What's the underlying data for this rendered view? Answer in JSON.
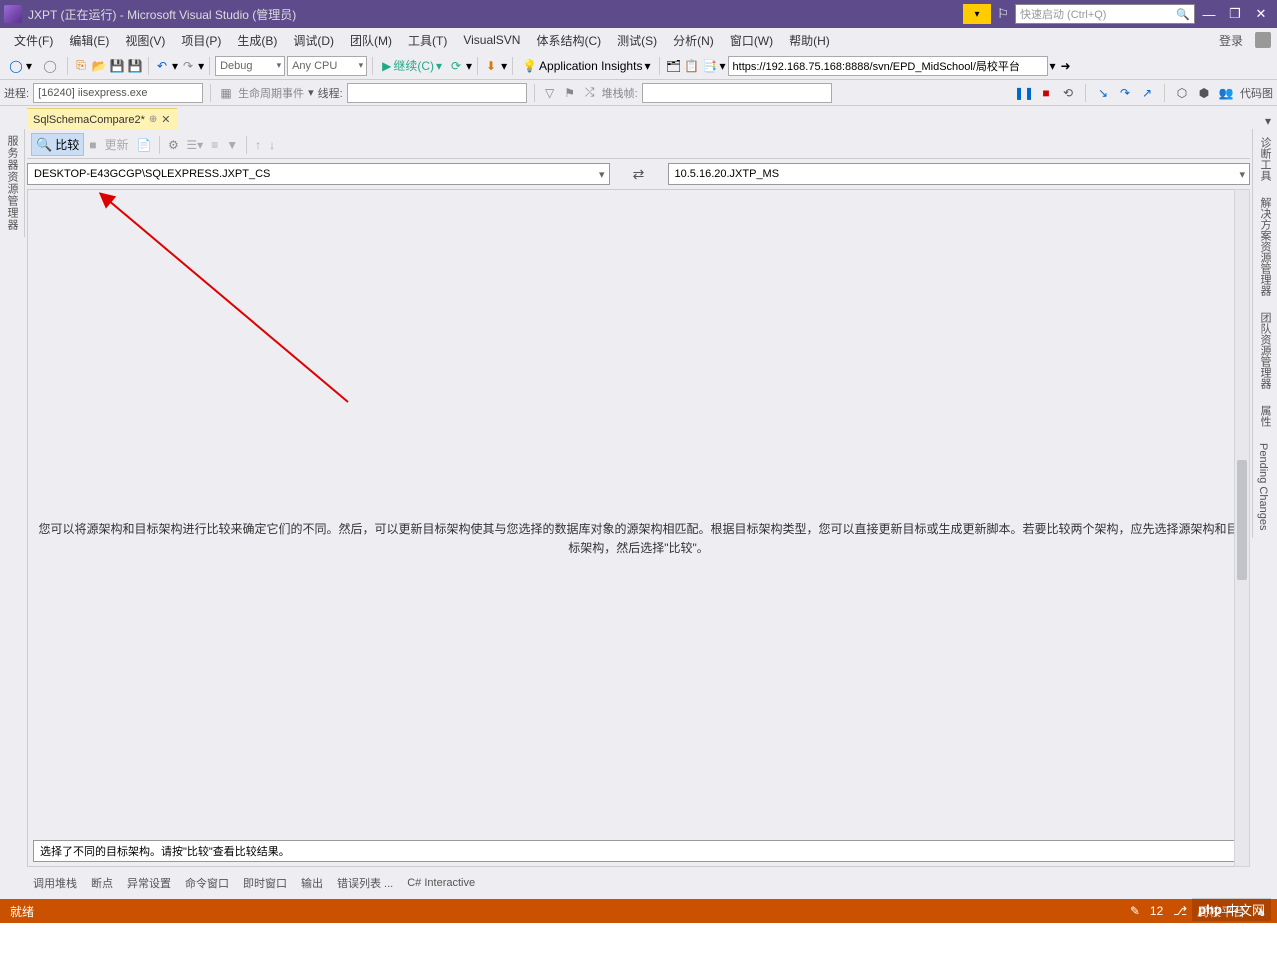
{
  "title": "JXPT (正在运行) - Microsoft Visual Studio  (管理员)",
  "quick_launch_placeholder": "快速启动 (Ctrl+Q)",
  "menu": [
    "文件(F)",
    "编辑(E)",
    "视图(V)",
    "项目(P)",
    "生成(B)",
    "调试(D)",
    "团队(M)",
    "工具(T)",
    "VisualSVN",
    "体系结构(C)",
    "测试(S)",
    "分析(N)",
    "窗口(W)",
    "帮助(H)"
  ],
  "login": "登录",
  "toolbar1": {
    "config": "Debug",
    "platform": "Any CPU",
    "continue": "继续(C)",
    "insights": "Application Insights",
    "url": "https://192.168.75.168:8888/svn/EPD_MidSchool/局校平台",
    "codemap": "代码图"
  },
  "toolbar2": {
    "proc_label": "进程:",
    "proc_value": "[16240] iisexpress.exe",
    "life_events": "生命周期事件",
    "thread_label": "线程:",
    "stackframe": "堆栈帧:"
  },
  "doc_tab": "SqlSchemaCompare2*",
  "sidebar_left": "服务器资源管理器",
  "sidebar_right": [
    "诊断工具",
    "解决方案资源管理器",
    "团队资源管理器",
    "属性",
    "Pending Changes"
  ],
  "compare": {
    "button": "比较",
    "stop": "■",
    "update": "更新",
    "source": "DESKTOP-E43GCGP\\SQLEXPRESS.JXPT_CS",
    "target": "10.5.16.20.JXTP_MS"
  },
  "main_info": "您可以将源架构和目标架构进行比较来确定它们的不同。然后，可以更新目标架构使其与您选择的数据库对象的源架构相匹配。根据目标架构类型，您可以直接更新目标或生成更新脚本。若要比较两个架构，应先选择源架构和目标架构，然后选择\"比较\"。",
  "bottom_msg": "选择了不同的目标架构。请按\"比较\"查看比较结果。",
  "output_tabs": [
    "调用堆栈",
    "断点",
    "异常设置",
    "命令窗口",
    "即时窗口",
    "输出",
    "错误列表 ...",
    "C# Interactive"
  ],
  "status": {
    "ready": "就绪",
    "count": "12",
    "pub": "局校平台"
  },
  "watermark": "中文网"
}
